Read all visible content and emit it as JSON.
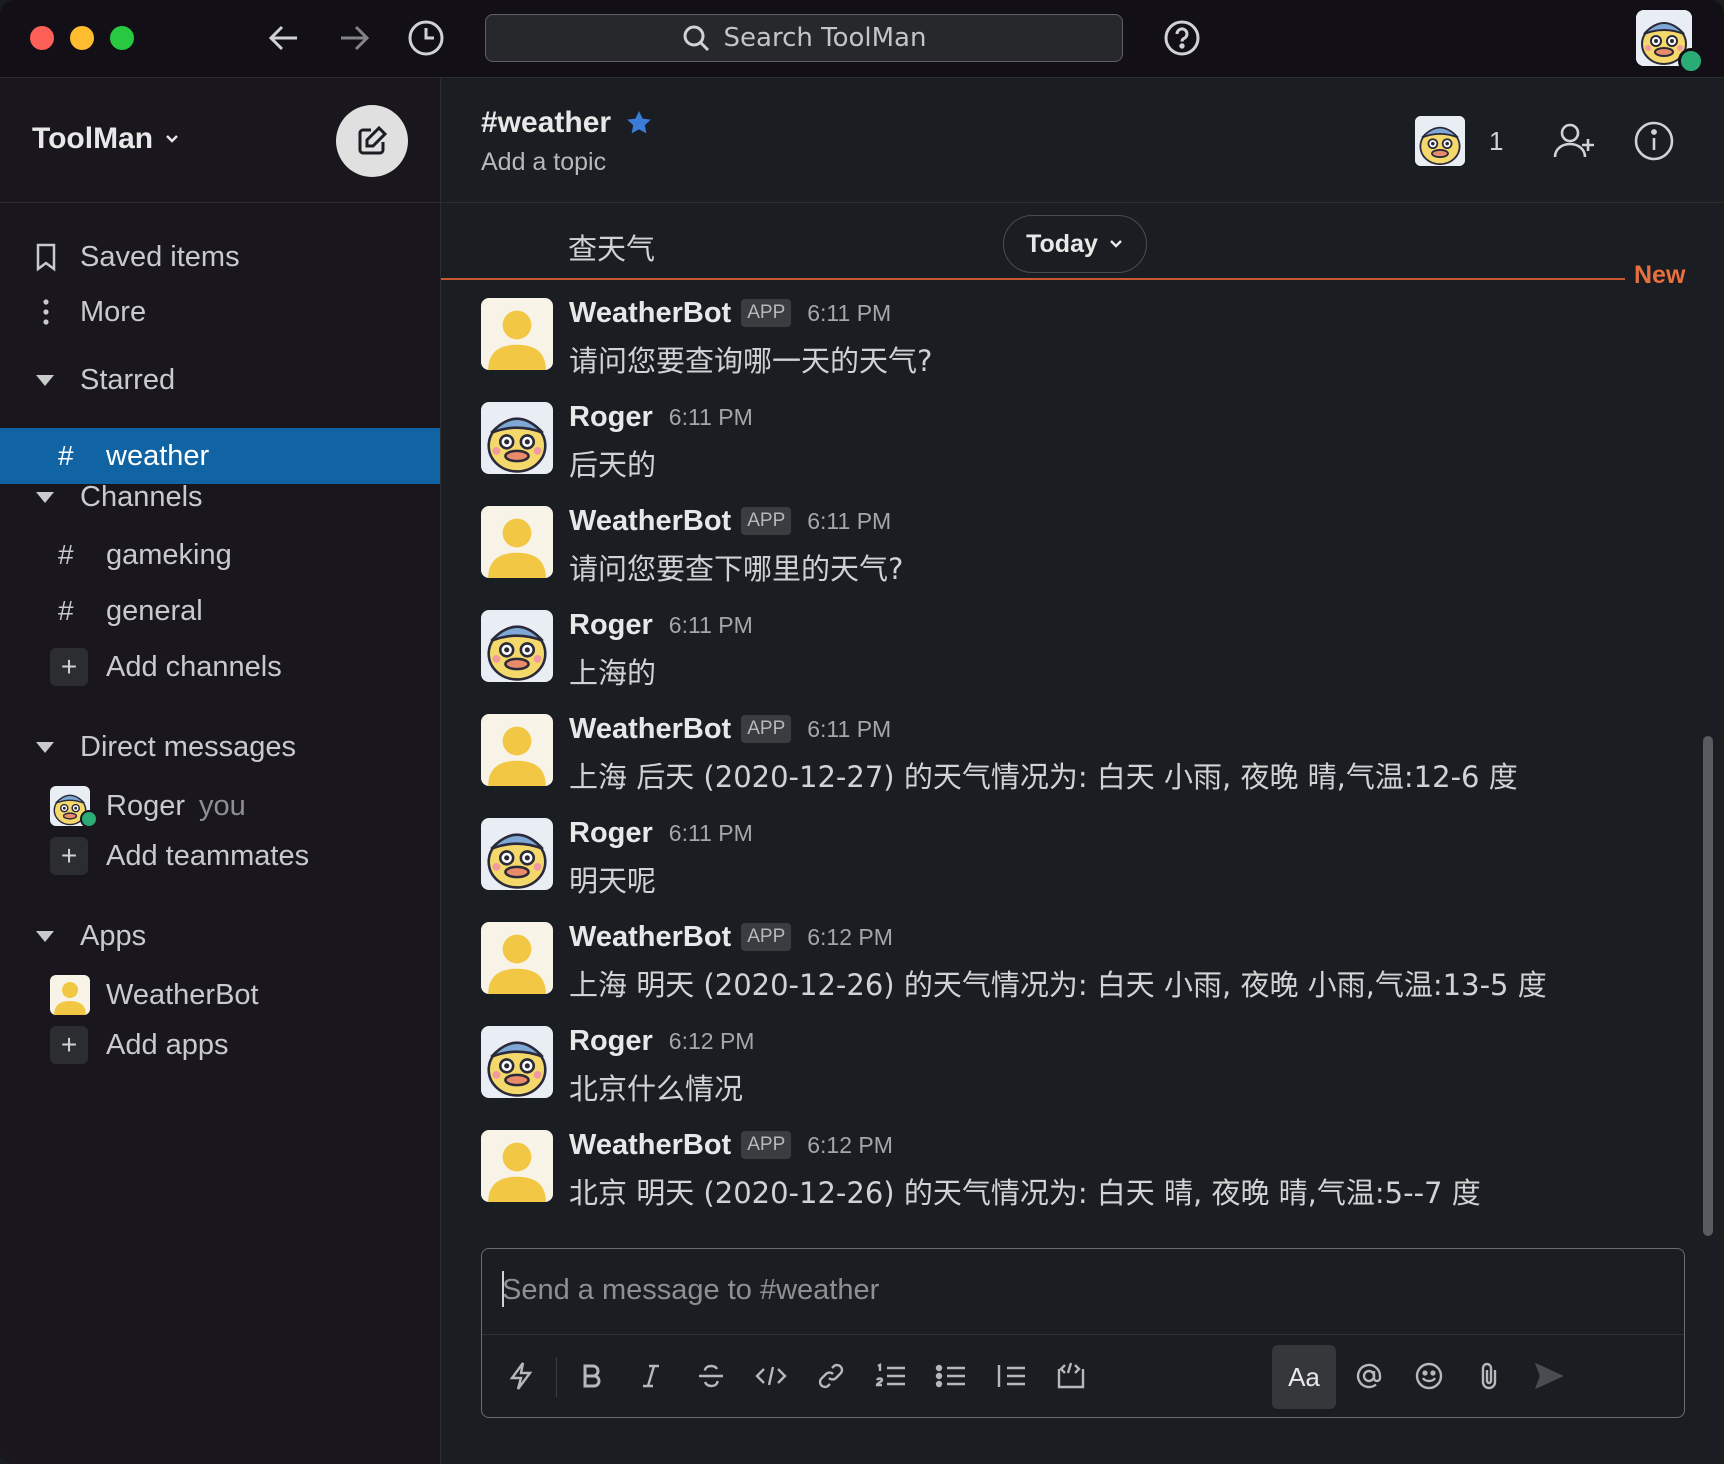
{
  "app": {
    "search_placeholder": "Search ToolMan"
  },
  "workspace": {
    "name": "ToolMan"
  },
  "sidebar": {
    "saved_items": "Saved items",
    "more": "More",
    "starred_header": "Starred",
    "starred": [
      {
        "label": "weather"
      }
    ],
    "channels_header": "Channels",
    "channels": [
      {
        "label": "gameking"
      },
      {
        "label": "general"
      }
    ],
    "add_channels": "Add channels",
    "dm_header": "Direct messages",
    "dms": [
      {
        "label": "Roger",
        "suffix": "you"
      }
    ],
    "add_teammates": "Add teammates",
    "apps_header": "Apps",
    "apps": [
      {
        "label": "WeatherBot"
      }
    ],
    "add_apps": "Add apps"
  },
  "channel": {
    "title": "#weather",
    "topic": "Add a topic",
    "member_count": "1"
  },
  "timeline": {
    "partial_message": "查天气",
    "date_pill": "Today",
    "new_label": "New"
  },
  "messages": [
    {
      "author": "WeatherBot",
      "badge": "APP",
      "time": "6:11 PM",
      "text": "请问您要查询哪一天的天气?"
    },
    {
      "author": "Roger",
      "badge": "",
      "time": "6:11 PM",
      "text": "后天的"
    },
    {
      "author": "WeatherBot",
      "badge": "APP",
      "time": "6:11 PM",
      "text": "请问您要查下哪里的天气?"
    },
    {
      "author": "Roger",
      "badge": "",
      "time": "6:11 PM",
      "text": "上海的"
    },
    {
      "author": "WeatherBot",
      "badge": "APP",
      "time": "6:11 PM",
      "text": "上海 后天 (2020-12-27) 的天气情况为: 白天 小雨, 夜晚 晴,气温:12-6 度"
    },
    {
      "author": "Roger",
      "badge": "",
      "time": "6:11 PM",
      "text": "明天呢"
    },
    {
      "author": "WeatherBot",
      "badge": "APP",
      "time": "6:12 PM",
      "text": "上海 明天 (2020-12-26) 的天气情况为: 白天 小雨, 夜晚 小雨,气温:13-5 度"
    },
    {
      "author": "Roger",
      "badge": "",
      "time": "6:12 PM",
      "text": "北京什么情况"
    },
    {
      "author": "WeatherBot",
      "badge": "APP",
      "time": "6:12 PM",
      "text": "北京 明天 (2020-12-26) 的天气情况为: 白天 晴, 夜晚 晴,气温:5--7 度"
    }
  ],
  "composer": {
    "placeholder": "Send a message to #weather",
    "format_label": "Aa"
  },
  "colors": {
    "accent": "#1164a3",
    "new_divider": "#c9582e",
    "presence": "#2bac76",
    "bot_avatar": "#f2c744"
  }
}
